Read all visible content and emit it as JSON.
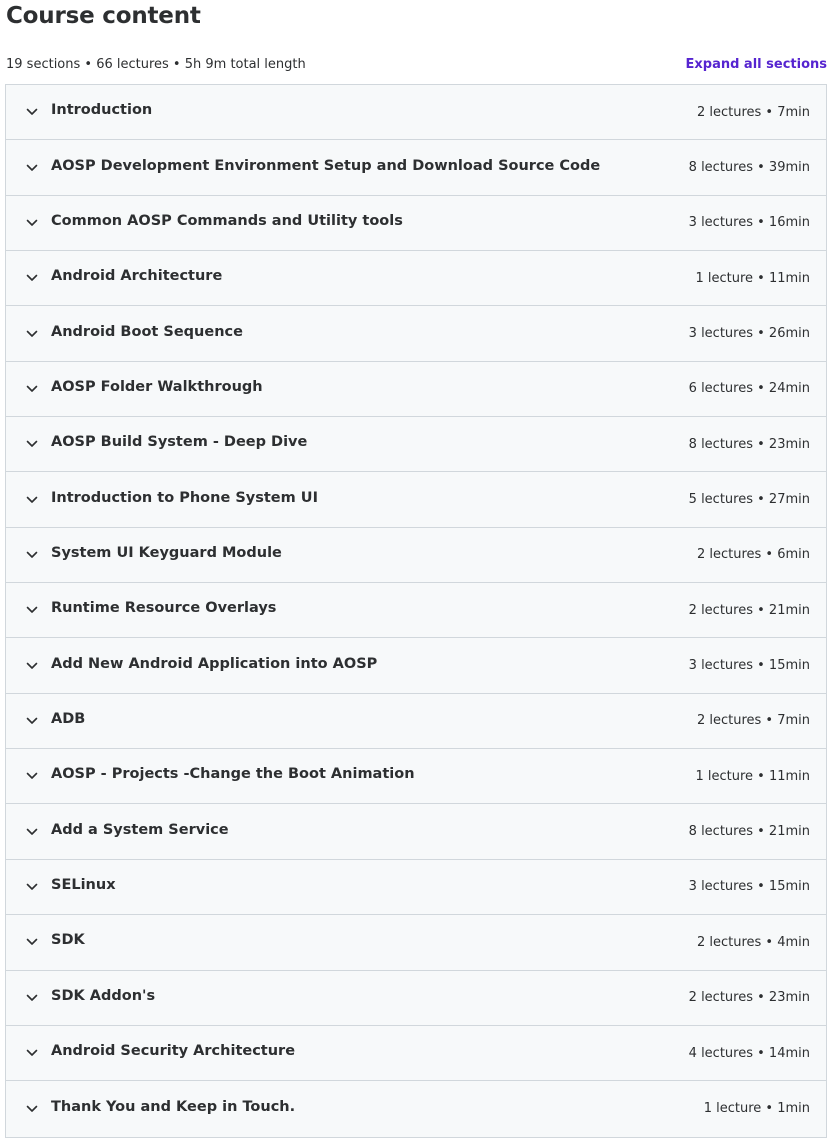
{
  "header": {
    "title": "Course content",
    "summary": "19 sections • 66 lectures • 5h 9m total length",
    "expand_label": "Expand all sections"
  },
  "icons": {
    "section_toggle": "chevron-down-icon"
  },
  "sections": [
    {
      "title": "Introduction",
      "meta": "2 lectures • 7min"
    },
    {
      "title": "AOSP Development Environment Setup and Download Source Code",
      "meta": "8 lectures • 39min"
    },
    {
      "title": "Common AOSP Commands and Utility tools",
      "meta": "3 lectures • 16min"
    },
    {
      "title": "Android Architecture",
      "meta": "1 lecture • 11min"
    },
    {
      "title": "Android Boot Sequence",
      "meta": "3 lectures • 26min"
    },
    {
      "title": "AOSP Folder Walkthrough",
      "meta": "6 lectures • 24min"
    },
    {
      "title": "AOSP Build System - Deep Dive",
      "meta": "8 lectures • 23min"
    },
    {
      "title": "Introduction to Phone System UI",
      "meta": "5 lectures • 27min"
    },
    {
      "title": "System UI Keyguard Module",
      "meta": "2 lectures • 6min"
    },
    {
      "title": "Runtime Resource Overlays",
      "meta": "2 lectures • 21min"
    },
    {
      "title": "Add New Android Application into AOSP",
      "meta": "3 lectures • 15min"
    },
    {
      "title": "ADB",
      "meta": "2 lectures • 7min"
    },
    {
      "title": "AOSP - Projects -Change the Boot Animation",
      "meta": "1 lecture • 11min"
    },
    {
      "title": "Add a System Service",
      "meta": "8 lectures • 21min"
    },
    {
      "title": "SELinux",
      "meta": "3 lectures • 15min"
    },
    {
      "title": "SDK",
      "meta": "2 lectures • 4min"
    },
    {
      "title": "SDK Addon's",
      "meta": "2 lectures • 23min"
    },
    {
      "title": "Android Security Architecture",
      "meta": "4 lectures • 14min"
    },
    {
      "title": "Thank You and Keep in Touch.",
      "meta": "1 lecture • 1min"
    }
  ]
}
